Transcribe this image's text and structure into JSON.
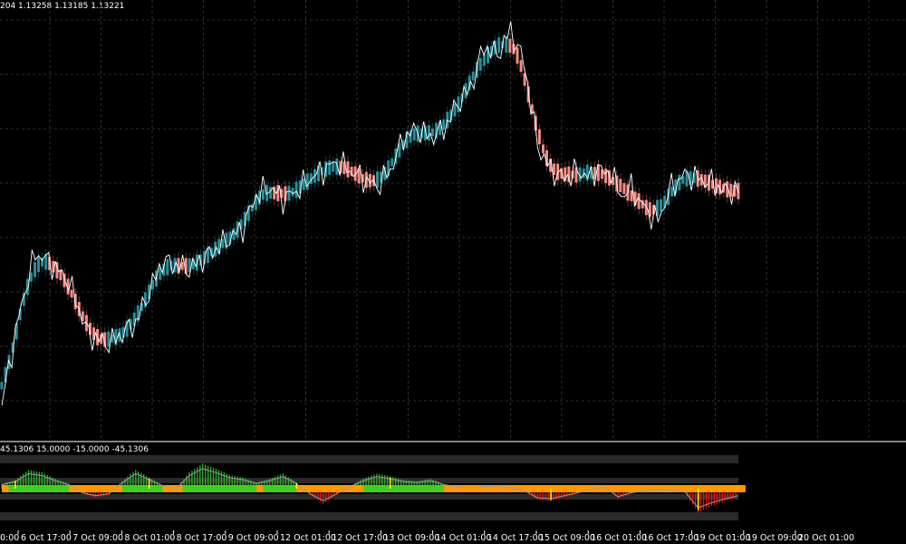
{
  "header": {
    "ohlc": "204 1.13258 1.13185 1.13221",
    "indicator_values": "45.1306 15.0000 -15.0000 -45.1306"
  },
  "colors": {
    "background": "#000000",
    "grid": "#2e2e2e",
    "price_line": "#ffffff",
    "bull_candle": "#2a8e98",
    "bear_candle": "#f48c86",
    "band_fill": "#2a2a2a",
    "osc_pos": "#2faa2f",
    "osc_neg": "#e01010",
    "signal_green": "#44cc22",
    "signal_orange": "#ff9900",
    "marker_yellow": "#ffff00"
  },
  "chart_data": [
    {
      "type": "line",
      "title": "",
      "xlabel": "",
      "ylabel": "",
      "ylim": [
        0,
        100
      ],
      "grid": true,
      "series": [
        {
          "x": [
            0,
            1,
            3,
            5,
            7,
            10,
            13,
            16,
            20,
            24,
            28,
            32,
            36,
            38,
            40,
            42,
            44,
            46,
            48,
            50,
            52,
            54,
            56,
            58,
            60,
            62,
            64,
            66,
            68,
            70,
            72,
            74,
            76,
            78,
            80,
            82,
            84,
            86,
            88,
            89,
            90,
            91,
            92,
            93,
            94,
            95,
            96,
            97,
            98,
            100,
            102,
            104,
            106,
            108,
            110
          ],
          "values": [
            5,
            14,
            30,
            42,
            40,
            35,
            22,
            20,
            25,
            40,
            38,
            43,
            48,
            56,
            58,
            55,
            57,
            60,
            62,
            64,
            62,
            60,
            58,
            62,
            70,
            72,
            70,
            72,
            78,
            82,
            92,
            90,
            96,
            88,
            68,
            62,
            60,
            62,
            60,
            63,
            61,
            62,
            57,
            56,
            58,
            55,
            53,
            51,
            50,
            58,
            61,
            60,
            59,
            57,
            57
          ]
        }
      ]
    },
    {
      "type": "bar",
      "title": "",
      "ylim": [
        -55,
        55
      ],
      "reference_levels": [
        45.1306,
        15.0,
        -15.0,
        -45.1306
      ],
      "series": [
        {
          "x": [
            0,
            2,
            4,
            6,
            8,
            10,
            12,
            14,
            16,
            18,
            20,
            22,
            24,
            26,
            28,
            30,
            32,
            34,
            36,
            38,
            40,
            42,
            44,
            46,
            48,
            50,
            52,
            54,
            56,
            58,
            60,
            62,
            64,
            66,
            68,
            70,
            72,
            74,
            76,
            78,
            80,
            82,
            84,
            86,
            88,
            90,
            92,
            94,
            96,
            98,
            100,
            102,
            104,
            106,
            108,
            110
          ],
          "values": [
            8,
            14,
            30,
            26,
            16,
            8,
            -8,
            -14,
            -10,
            12,
            30,
            18,
            6,
            0,
            26,
            40,
            32,
            22,
            18,
            10,
            16,
            24,
            10,
            -10,
            -24,
            -10,
            4,
            16,
            24,
            20,
            14,
            12,
            16,
            8,
            4,
            2,
            4,
            6,
            2,
            -4,
            -18,
            -20,
            -14,
            -8,
            -2,
            4,
            -16,
            -8,
            -4,
            -2,
            -4,
            -6,
            -38,
            -28,
            -20,
            -14
          ]
        }
      ]
    }
  ],
  "x_axis": {
    "tick_labels": [
      "6 Oct 17:00",
      "7 Oct 09:00",
      "8 Oct 01:00",
      "8 Oct 17:00",
      "9 Oct 09:00",
      "12 Oct 01:00",
      "12 Oct 17:00",
      "13 Oct 09:00",
      "14 Oct 01:00",
      "14 Oct 17:00",
      "15 Oct 09:00",
      "16 Oct 01:00",
      "16 Oct 17:00",
      "19 Oct 01:00",
      "19 Oct 09:00",
      "20 Oct 01:00"
    ],
    "partial_first_label": "0:00"
  }
}
